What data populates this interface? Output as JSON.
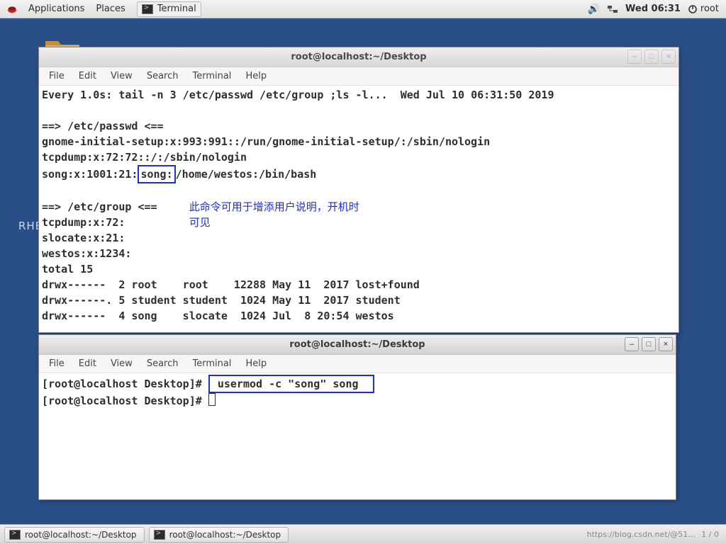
{
  "top_panel": {
    "applications": "Applications",
    "places": "Places",
    "launcher": "Terminal",
    "clock": "Wed 06:31",
    "user": "root"
  },
  "desktop": {
    "label": "RHEL"
  },
  "window_back": {
    "title": "root@localhost:~/Desktop",
    "menu": {
      "file": "File",
      "edit": "Edit",
      "view": "View",
      "search": "Search",
      "terminal": "Terminal",
      "help": "Help"
    },
    "lines": {
      "watch_left": "Every 1.0s: tail -n 3 /etc/passwd /etc/group ;ls -l...  ",
      "watch_right": "Wed Jul 10 06:31:50 2019",
      "hdr_passwd": "==> /etc/passwd <==",
      "p1": "gnome-initial-setup:x:993:991::/run/gnome-initial-setup/:/sbin/nologin",
      "p2": "tcpdump:x:72:72::/:/sbin/nologin",
      "p3_pre": "song:x:1001:21:",
      "p3_hl": "song:",
      "p3_post": "/home/westos:/bin/bash",
      "hdr_group": "==> /etc/group <==",
      "annot1": "此命令可用于增添用户说明，开机时",
      "annot2": "可见",
      "g1": "tcpdump:x:72:",
      "g2": "slocate:x:21:",
      "g3": "westos:x:1234:",
      "total": "total 15",
      "ls1": "drwx------  2 root    root    12288 May 11  2017 lost+found",
      "ls2": "drwx------. 5 student student  1024 May 11  2017 student",
      "ls3": "drwx------  4 song    slocate  1024 Jul  8 20:54 westos"
    }
  },
  "window_front": {
    "title": "root@localhost:~/Desktop",
    "menu": {
      "file": "File",
      "edit": "Edit",
      "view": "View",
      "search": "Search",
      "terminal": "Terminal",
      "help": "Help"
    },
    "prompt": "[root@localhost Desktop]#",
    "cmd_hl": "usermod -c \"song\" song"
  },
  "taskbar": {
    "task1": "root@localhost:~/Desktop",
    "task2": "root@localhost:~/Desktop",
    "watermark": "https://blog.csdn.net/@51…",
    "pager": "1 / 0"
  },
  "icons": {
    "volume": "volume-icon",
    "network": "network-icon",
    "power": "power-icon"
  }
}
